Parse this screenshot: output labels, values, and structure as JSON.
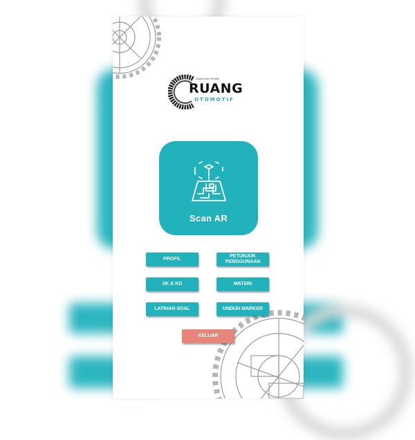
{
  "app": {
    "logo": {
      "tagline": "Augmented Reality",
      "title": "RUANG",
      "subtitle": "OTOMOTIF"
    },
    "scan": {
      "label": "Scan AR",
      "icon": "ar-scan-icon"
    },
    "menu": [
      {
        "id": "profil",
        "label": "PROFIL"
      },
      {
        "id": "petunjuk",
        "label": "PETUNJUK PENGGUNAAN"
      },
      {
        "id": "skkd",
        "label": "SK & KD"
      },
      {
        "id": "materi",
        "label": "MATERI"
      },
      {
        "id": "latihan",
        "label": "LATIHAN SOAL"
      },
      {
        "id": "unduh",
        "label": "UNDUH MARKER"
      }
    ],
    "exit": {
      "label": "KELUAR"
    },
    "colors": {
      "accent": "#21b2bc",
      "exit": "#e8857a",
      "logo_text": "#111111",
      "logo_sub": "#2aa7b2"
    }
  }
}
